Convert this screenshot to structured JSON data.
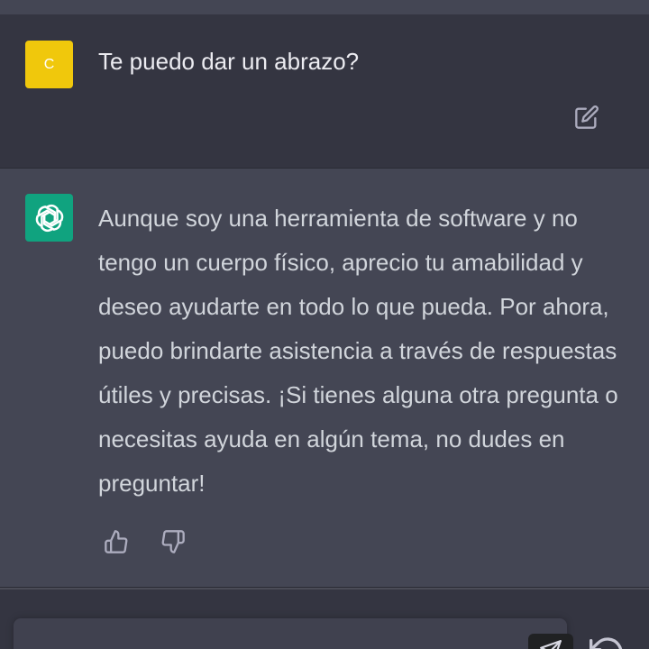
{
  "conversation": {
    "user_message": {
      "avatar_initial": "C",
      "text": "Te puedo dar un abrazo?",
      "edit_icon": "edit-icon"
    },
    "assistant_message": {
      "avatar_icon": "openai-logo-icon",
      "text": "Aunque soy una herramienta de software y no tengo un cuerpo físico, aprecio tu amabilidad y deseo ayudarte en todo lo que pueda. Por ahora, puedo brindarte asistencia a través de respuestas útiles y precisas. ¡Si tienes alguna otra pregunta o necesitas ayuda en algún tema, no dudes en preguntar!",
      "feedback_icons": [
        "thumbs-up-icon",
        "thumbs-down-icon"
      ]
    }
  },
  "composer": {
    "input_value": "",
    "send_icon": "send-icon",
    "regenerate_icon": "regenerate-icon"
  },
  "colors": {
    "user_avatar": "#f0c80c",
    "bot_avatar": "#10a37f",
    "user_row_bg": "#343541",
    "assistant_row_bg": "#444654"
  }
}
